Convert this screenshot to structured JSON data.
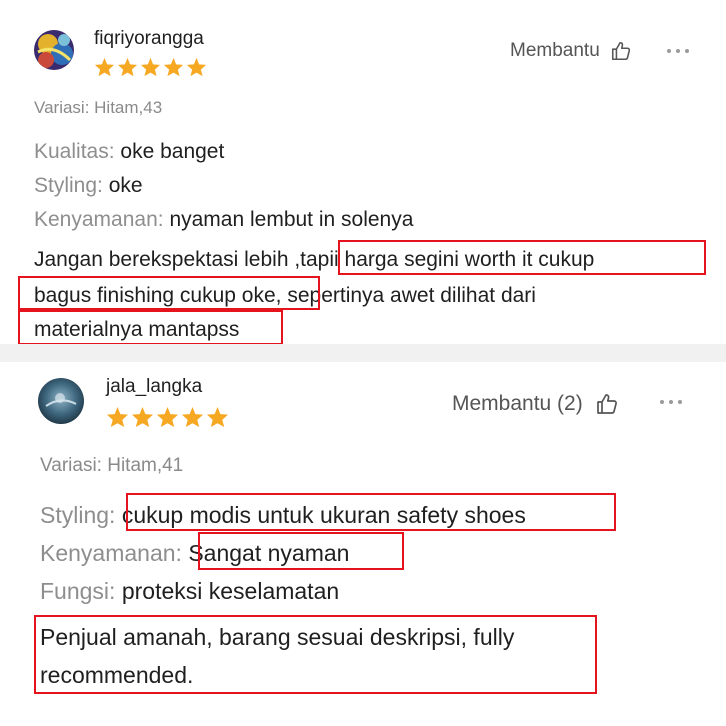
{
  "reviews": [
    {
      "username": "fiqriyorangga",
      "rating": 5,
      "helpful_label": "Membantu",
      "variant": "Variasi: Hitam,43",
      "attributes": [
        {
          "key": "Kualitas: ",
          "value": "oke banget"
        },
        {
          "key": "Styling: ",
          "value": "oke"
        },
        {
          "key": "Kenyamanan: ",
          "value": "nyaman lembut in solenya"
        }
      ],
      "comment_lines": [
        "Jangan berekspektasi lebih ,tapii harga segini worth it cukup",
        "bagus finishing cukup oke, sepertinya awet dilihat dari",
        "materialnya mantapss"
      ]
    },
    {
      "username": "jala_langka",
      "rating": 5,
      "helpful_label": "Membantu (2)",
      "variant": "Variasi: Hitam,41",
      "attributes": [
        {
          "key": "Styling: ",
          "value": "cukup modis untuk ukuran safety shoes"
        },
        {
          "key": "Kenyamanan: ",
          "value": "Sangat nyaman"
        },
        {
          "key": "Fungsi: ",
          "value": "proteksi keselamatan"
        }
      ],
      "comment_lines": [
        "Penjual amanah, barang sesuai deskripsi, fully",
        "recommended."
      ]
    }
  ],
  "colors": {
    "star": "#f7a823",
    "highlight_box": "#e5131d",
    "separator": "#f1f1f1"
  },
  "icons": [
    "thumbs-up-icon",
    "more-options-icon",
    "star-icon"
  ]
}
